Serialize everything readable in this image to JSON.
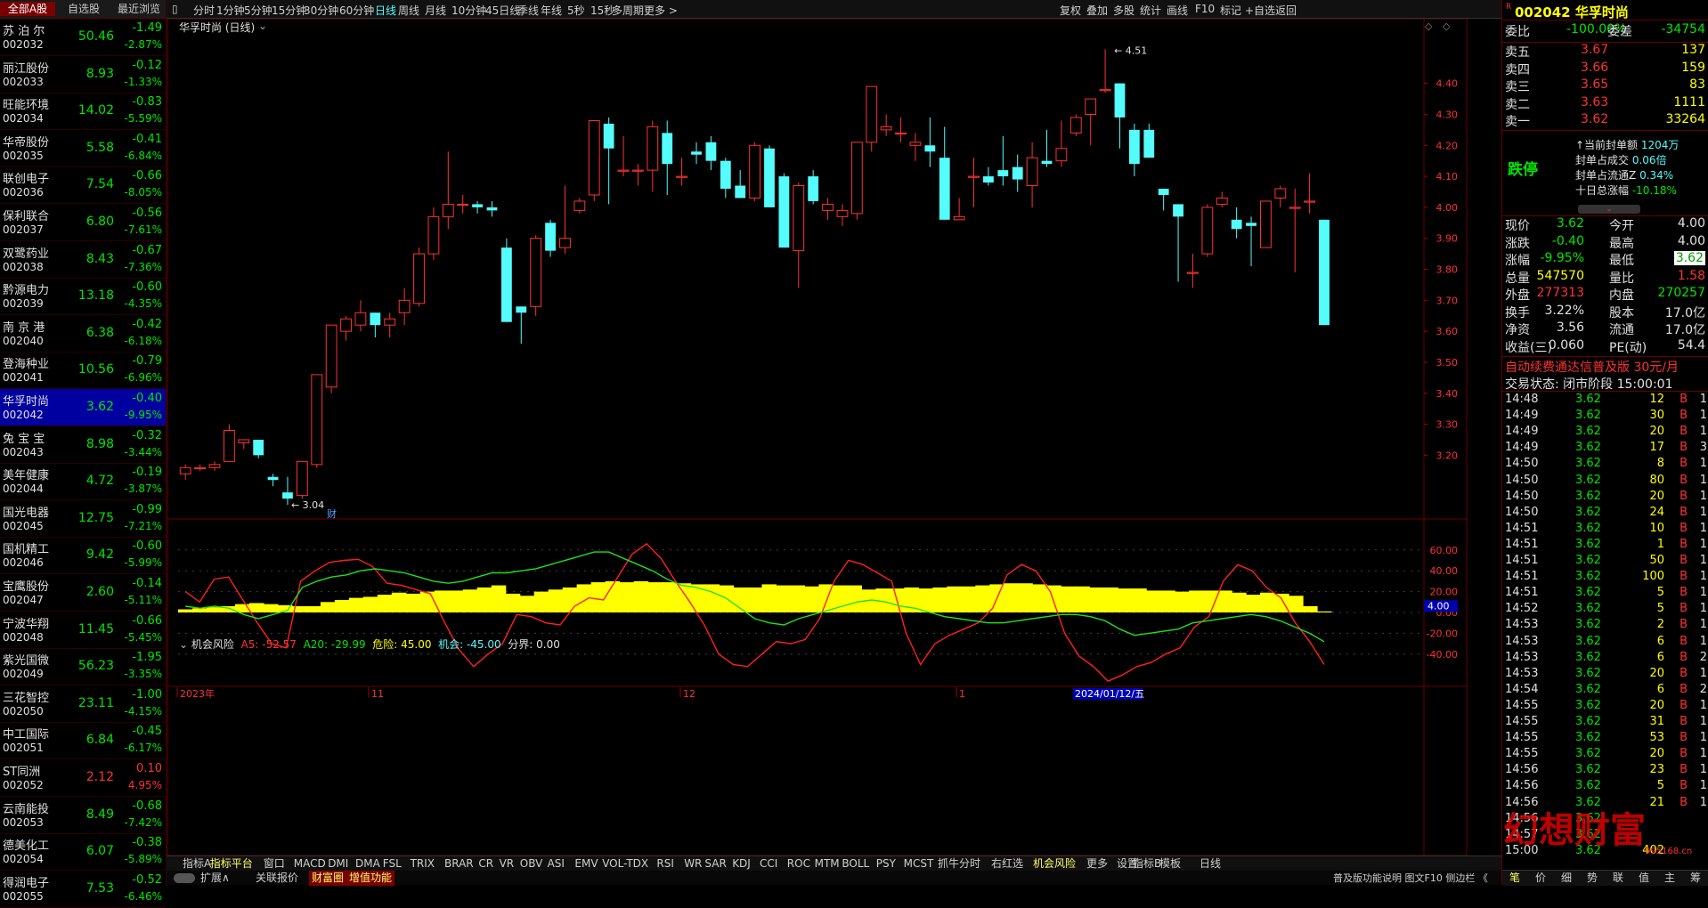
{
  "left_tabs": [
    "全部A股",
    "自选股",
    "最近浏览"
  ],
  "stocks": [
    {
      "name": "苏 泊 尔",
      "code": "002032",
      "price": "50.46",
      "chg": "-1.49",
      "pct": "-2.87%",
      "up": false
    },
    {
      "name": "丽江股份",
      "code": "002033",
      "price": "8.93",
      "chg": "-0.12",
      "pct": "-1.33%",
      "up": false
    },
    {
      "name": "旺能环境",
      "code": "002034",
      "price": "14.02",
      "chg": "-0.83",
      "pct": "-5.59%",
      "up": false
    },
    {
      "name": "华帝股份",
      "code": "002035",
      "price": "5.58",
      "chg": "-0.41",
      "pct": "-6.84%",
      "up": false
    },
    {
      "name": "联创电子",
      "code": "002036",
      "price": "7.54",
      "chg": "-0.66",
      "pct": "-8.05%",
      "up": false
    },
    {
      "name": "保利联合",
      "code": "002037",
      "price": "6.80",
      "chg": "-0.56",
      "pct": "-7.61%",
      "up": false
    },
    {
      "name": "双鹭药业",
      "code": "002038",
      "price": "8.43",
      "chg": "-0.67",
      "pct": "-7.36%",
      "up": false
    },
    {
      "name": "黔源电力",
      "code": "002039",
      "price": "13.18",
      "chg": "-0.60",
      "pct": "-4.35%",
      "up": false
    },
    {
      "name": "南 京 港",
      "code": "002040",
      "price": "6.38",
      "chg": "-0.42",
      "pct": "-6.18%",
      "up": false
    },
    {
      "name": "登海种业",
      "code": "002041",
      "price": "10.56",
      "chg": "-0.79",
      "pct": "-6.96%",
      "up": false
    },
    {
      "name": "华孚时尚",
      "code": "002042",
      "price": "3.62",
      "chg": "-0.40",
      "pct": "-9.95%",
      "up": false,
      "selected": true
    },
    {
      "name": "兔 宝 宝",
      "code": "002043",
      "price": "8.98",
      "chg": "-0.32",
      "pct": "-3.44%",
      "up": false
    },
    {
      "name": "美年健康",
      "code": "002044",
      "price": "4.72",
      "chg": "-0.19",
      "pct": "-3.87%",
      "up": false
    },
    {
      "name": "国光电器",
      "code": "002045",
      "price": "12.75",
      "chg": "-0.99",
      "pct": "-7.21%",
      "up": false
    },
    {
      "name": "国机精工",
      "code": "002046",
      "price": "9.42",
      "chg": "-0.60",
      "pct": "-5.99%",
      "up": false
    },
    {
      "name": "宝鹰股份",
      "code": "002047",
      "price": "2.60",
      "chg": "-0.14",
      "pct": "-5.11%",
      "up": false
    },
    {
      "name": "宁波华翔",
      "code": "002048",
      "price": "11.45",
      "chg": "-0.66",
      "pct": "-5.45%",
      "up": false
    },
    {
      "name": "紫光国微",
      "code": "002049",
      "price": "56.23",
      "chg": "-1.95",
      "pct": "-3.35%",
      "up": false
    },
    {
      "name": "三花智控",
      "code": "002050",
      "price": "23.11",
      "chg": "-1.00",
      "pct": "-4.15%",
      "up": false
    },
    {
      "name": "中工国际",
      "code": "002051",
      "price": "6.84",
      "chg": "-0.45",
      "pct": "-6.17%",
      "up": false
    },
    {
      "name": "ST同洲",
      "code": "002052",
      "price": "2.12",
      "chg": "0.10",
      "pct": "4.95%",
      "up": true
    },
    {
      "name": "云南能投",
      "code": "002053",
      "price": "8.49",
      "chg": "-0.68",
      "pct": "-7.42%",
      "up": false
    },
    {
      "name": "德美化工",
      "code": "002054",
      "price": "6.07",
      "chg": "-0.38",
      "pct": "-5.89%",
      "up": false
    },
    {
      "name": "得润电子",
      "code": "002055",
      "price": "7.53",
      "chg": "-0.52",
      "pct": "-6.46%",
      "up": false
    }
  ],
  "toolbar_left": [
    "分时",
    "1分钟",
    "5分钟",
    "15分钟",
    "30分钟",
    "60分钟",
    "日线",
    "周线",
    "月线",
    "10分钟",
    "45日线",
    "季线",
    "年线",
    "5秒",
    "15秒",
    "多周期",
    "更多 >"
  ],
  "toolbar_right": [
    "复权",
    "叠加",
    "多股",
    "统计",
    "画线",
    "F10",
    "标记",
    "+自选",
    "返回"
  ],
  "chart_title": "华孚时尚 (日线)",
  "chart_data": {
    "type": "candlestick",
    "y_ticks": [
      3.2,
      3.3,
      3.4,
      3.5,
      3.6,
      3.7,
      3.8,
      3.9,
      4.0,
      4.1,
      4.2,
      4.3,
      4.4
    ],
    "ylim": [
      3.0,
      4.58
    ],
    "candles": [
      [
        3.14,
        3.16,
        3.12,
        3.17
      ],
      [
        3.16,
        3.16,
        3.15,
        3.17
      ],
      [
        3.16,
        3.17,
        3.15,
        3.18
      ],
      [
        3.18,
        3.28,
        3.18,
        3.3
      ],
      [
        3.24,
        3.25,
        3.22,
        3.25
      ],
      [
        3.25,
        3.2,
        3.19,
        3.25
      ],
      [
        3.13,
        3.12,
        3.1,
        3.14
      ],
      [
        3.08,
        3.06,
        3.04,
        3.13
      ],
      [
        3.07,
        3.18,
        3.06,
        3.18
      ],
      [
        3.17,
        3.46,
        3.16,
        3.46
      ],
      [
        3.42,
        3.62,
        3.4,
        3.62
      ],
      [
        3.6,
        3.64,
        3.57,
        3.65
      ],
      [
        3.62,
        3.66,
        3.6,
        3.7
      ],
      [
        3.66,
        3.62,
        3.58,
        3.66
      ],
      [
        3.62,
        3.64,
        3.58,
        3.66
      ],
      [
        3.66,
        3.7,
        3.62,
        3.74
      ],
      [
        3.69,
        3.85,
        3.68,
        3.87
      ],
      [
        3.85,
        3.97,
        3.83,
        4.0
      ],
      [
        3.97,
        4.01,
        3.93,
        4.18
      ],
      [
        4.01,
        4.01,
        3.98,
        4.04
      ],
      [
        4.01,
        4.0,
        3.98,
        4.02
      ],
      [
        4.0,
        3.99,
        3.97,
        4.02
      ],
      [
        3.87,
        3.63,
        3.63,
        3.9
      ],
      [
        3.68,
        3.66,
        3.56,
        3.68
      ],
      [
        3.68,
        3.9,
        3.65,
        3.91
      ],
      [
        3.95,
        3.86,
        3.84,
        3.96
      ],
      [
        3.87,
        3.9,
        3.85,
        4.07
      ],
      [
        3.99,
        4.02,
        3.98,
        4.03
      ],
      [
        4.04,
        4.28,
        4.02,
        4.28
      ],
      [
        4.27,
        4.19,
        4.01,
        4.29
      ],
      [
        4.12,
        4.12,
        4.1,
        4.23
      ],
      [
        4.12,
        4.12,
        4.07,
        4.14
      ],
      [
        4.12,
        4.26,
        4.05,
        4.28
      ],
      [
        4.24,
        4.14,
        4.04,
        4.28
      ],
      [
        4.1,
        4.1,
        4.07,
        4.16
      ],
      [
        4.18,
        4.17,
        4.14,
        4.21
      ],
      [
        4.21,
        4.15,
        4.12,
        4.23
      ],
      [
        4.15,
        4.06,
        4.03,
        4.16
      ],
      [
        4.07,
        4.03,
        4.03,
        4.12
      ],
      [
        4.03,
        4.2,
        4.02,
        4.21
      ],
      [
        4.19,
        4.0,
        4.0,
        4.2
      ],
      [
        4.1,
        3.87,
        3.87,
        4.11
      ],
      [
        3.86,
        4.07,
        3.74,
        4.08
      ],
      [
        4.1,
        4.02,
        4.01,
        4.12
      ],
      [
        3.99,
        4.01,
        3.96,
        4.03
      ],
      [
        3.97,
        3.99,
        3.94,
        4.01
      ],
      [
        3.98,
        4.21,
        3.96,
        4.21
      ],
      [
        4.21,
        4.39,
        4.18,
        4.39
      ],
      [
        4.25,
        4.26,
        4.23,
        4.3
      ],
      [
        4.24,
        4.24,
        4.21,
        4.29
      ],
      [
        4.2,
        4.21,
        4.15,
        4.24
      ],
      [
        4.2,
        4.18,
        4.13,
        4.29
      ],
      [
        4.16,
        3.96,
        3.96,
        4.26
      ],
      [
        3.96,
        3.97,
        3.96,
        4.03
      ],
      [
        4.1,
        4.1,
        4.0,
        4.16
      ],
      [
        4.1,
        4.08,
        4.07,
        4.13
      ],
      [
        4.12,
        4.1,
        4.07,
        4.23
      ],
      [
        4.13,
        4.09,
        4.05,
        4.17
      ],
      [
        4.07,
        4.16,
        4.0,
        4.21
      ],
      [
        4.15,
        4.14,
        4.13,
        4.25
      ],
      [
        4.15,
        4.19,
        4.13,
        4.28
      ],
      [
        4.24,
        4.29,
        4.23,
        4.3
      ],
      [
        4.3,
        4.35,
        4.2,
        4.35
      ],
      [
        4.38,
        4.38,
        4.37,
        4.51
      ],
      [
        4.4,
        4.29,
        4.19,
        4.4
      ],
      [
        4.25,
        4.14,
        4.1,
        4.27
      ],
      [
        4.25,
        4.16,
        4.16,
        4.27
      ],
      [
        4.06,
        4.04,
        3.99,
        4.06
      ],
      [
        4.01,
        3.97,
        3.76,
        4.01
      ],
      [
        3.79,
        3.79,
        3.74,
        3.85
      ],
      [
        3.85,
        4.0,
        3.84,
        4.01
      ],
      [
        4.01,
        4.03,
        4.0,
        4.05
      ],
      [
        3.96,
        3.93,
        3.9,
        4.0
      ],
      [
        3.95,
        3.94,
        3.81,
        3.97
      ],
      [
        3.87,
        4.02,
        3.87,
        4.02
      ],
      [
        4.03,
        4.06,
        4.0,
        4.07
      ],
      [
        4.0,
        4.0,
        3.79,
        4.06
      ],
      [
        4.02,
        4.02,
        3.98,
        4.11
      ],
      [
        3.96,
        3.62,
        3.62,
        3.96
      ]
    ],
    "high_label": "4.51",
    "low_label": "3.04",
    "x_labels": [
      "2023年",
      "11",
      "12",
      "1",
      "2024/01/12/五"
    ]
  },
  "indicator": {
    "name": "机会风险",
    "a5": "A5: -52.57",
    "a20": "A20: -29.99",
    "danger": "危险: 45.00",
    "chance": "机会: -45.00",
    "boundary": "分界: 0.00",
    "y_ticks": [
      "60.00",
      "40.00",
      "20.00",
      "0.00",
      "-20.00",
      "-40.00"
    ],
    "current": "4.00",
    "fin_label": "财"
  },
  "bottom_tabs": [
    "指标A",
    "指标平台",
    "窗口",
    "MACD",
    "DMI",
    "DMA",
    "FSL",
    "TRIX",
    "BRAR",
    "CR",
    "VR",
    "OBV",
    "ASI",
    "EMV",
    "VOL-TDX",
    "RSI",
    "WR",
    "SAR",
    "KDJ",
    "CCI",
    "ROC",
    "MTM",
    "BOLL",
    "PSY",
    "MCST",
    "抓牛分时",
    "右红选",
    "机会风险",
    "更多",
    "设置"
  ],
  "bottom_right": [
    "指标B",
    "模板"
  ],
  "bottom_left2": [
    "扩展∧",
    "关联报价",
    "财富圈",
    "增值功能"
  ],
  "status_right": "普及版功能说明 图文F10 侧边栏 《",
  "right": {
    "code_title": "002042 华孚时尚",
    "weibi_label": "委比",
    "weibi": "-100.00%",
    "weicha_label": "委差",
    "weicha": "-34754",
    "asks": [
      {
        "label": "卖五",
        "price": "3.67",
        "vol": "137"
      },
      {
        "label": "卖四",
        "price": "3.66",
        "vol": "159"
      },
      {
        "label": "卖三",
        "price": "3.65",
        "vol": "83"
      },
      {
        "label": "卖二",
        "price": "3.63",
        "vol": "1111"
      },
      {
        "label": "卖一",
        "price": "3.62",
        "vol": "33264"
      }
    ],
    "limit_status": "跌停",
    "seal_info": [
      {
        "label": "↑当前封单额",
        "val": "1204万"
      },
      {
        "label": "封单占成交",
        "val": "0.06倍"
      },
      {
        "label": "封单占流通Z",
        "val": "0.34%"
      },
      {
        "label": "十日总涨幅",
        "val": "-10.18%"
      }
    ],
    "quote": [
      [
        "现价",
        "3.62",
        "今开",
        "4.00"
      ],
      [
        "涨跌",
        "-0.40",
        "最高",
        "4.00"
      ],
      [
        "涨幅",
        "-9.95%",
        "最低",
        "3.62"
      ],
      [
        "总量",
        "547570",
        "量比",
        "1.58"
      ],
      [
        "外盘",
        "277313",
        "内盘",
        "270257"
      ],
      [
        "换手",
        "3.22%",
        "股本",
        "17.0亿"
      ],
      [
        "净资",
        "3.56",
        "流通",
        "17.0亿"
      ],
      [
        "收益(三)",
        "0.060",
        "PE(动)",
        "54.4"
      ]
    ],
    "ad": "自动续费通达信普及版  30元/月",
    "trade_state": "交易状态: 闭市阶段  15:00:01",
    "ticks": [
      [
        "14:48",
        "3.62",
        "12",
        "B",
        "1"
      ],
      [
        "14:49",
        "3.62",
        "30",
        "B",
        "1"
      ],
      [
        "14:49",
        "3.62",
        "20",
        "B",
        "1"
      ],
      [
        "14:49",
        "3.62",
        "17",
        "B",
        "3"
      ],
      [
        "14:50",
        "3.62",
        "8",
        "B",
        "1"
      ],
      [
        "14:50",
        "3.62",
        "80",
        "B",
        "1"
      ],
      [
        "14:50",
        "3.62",
        "20",
        "B",
        "1"
      ],
      [
        "14:50",
        "3.62",
        "24",
        "B",
        "1"
      ],
      [
        "14:51",
        "3.62",
        "10",
        "B",
        "1"
      ],
      [
        "14:51",
        "3.62",
        "1",
        "B",
        "1"
      ],
      [
        "14:51",
        "3.62",
        "50",
        "B",
        "1"
      ],
      [
        "14:51",
        "3.62",
        "100",
        "B",
        "1"
      ],
      [
        "14:51",
        "3.62",
        "5",
        "B",
        "1"
      ],
      [
        "14:52",
        "3.62",
        "5",
        "B",
        "1"
      ],
      [
        "14:53",
        "3.62",
        "2",
        "B",
        "1"
      ],
      [
        "14:53",
        "3.62",
        "6",
        "B",
        "1"
      ],
      [
        "14:53",
        "3.62",
        "6",
        "B",
        "2"
      ],
      [
        "14:53",
        "3.62",
        "20",
        "B",
        "1"
      ],
      [
        "14:54",
        "3.62",
        "6",
        "B",
        "2"
      ],
      [
        "14:55",
        "3.62",
        "20",
        "B",
        "1"
      ],
      [
        "14:55",
        "3.62",
        "31",
        "B",
        "1"
      ],
      [
        "14:55",
        "3.62",
        "53",
        "B",
        "1"
      ],
      [
        "14:55",
        "3.62",
        "20",
        "B",
        "1"
      ],
      [
        "14:56",
        "3.62",
        "23",
        "B",
        "1"
      ],
      [
        "14:56",
        "3.62",
        "5",
        "B",
        "1"
      ],
      [
        "14:56",
        "3.62",
        "21",
        "B",
        "1"
      ],
      [
        "14:56",
        "3.62",
        "",
        "",
        ""
      ],
      [
        "14:57",
        "3.62",
        "",
        "",
        ""
      ],
      [
        "15:00",
        "3.62",
        "402",
        "",
        ""
      ]
    ],
    "bottom_tabs": [
      "笔",
      "价",
      "细",
      "势",
      "联",
      "值",
      "主",
      "筹"
    ],
    "watermark": "幻想财富",
    "watermark_url": "995168.cn"
  },
  "colors": {
    "up": "#ff3232",
    "down": "#54fcfc",
    "ma_red": "#ff2020",
    "ma_green": "#20e020",
    "bar_yellow": "#ffff00"
  }
}
